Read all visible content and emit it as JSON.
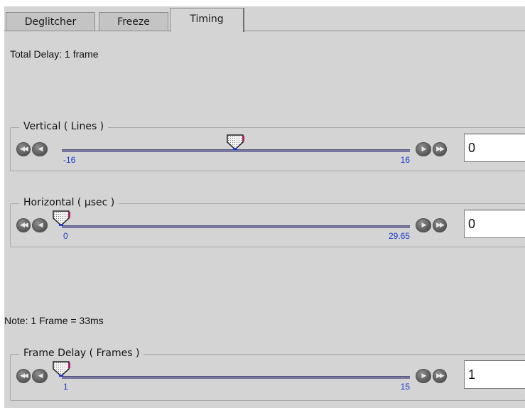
{
  "tabs": [
    {
      "label": "Deglitcher",
      "active": false
    },
    {
      "label": "Freeze",
      "active": false
    },
    {
      "label": "Timing",
      "active": true
    }
  ],
  "total_delay": "Total Delay: 1 frame",
  "note": "Note: 1 Frame = 33ms",
  "sliders": {
    "vertical": {
      "legend": "Vertical ( Lines )",
      "min": "-16",
      "max": "16",
      "value": "0",
      "level": 0.5
    },
    "horizontal": {
      "legend": "Horizontal ( µsec )",
      "min": "0",
      "max": "29.65",
      "value": "0",
      "level": 0.0
    },
    "frame_delay": {
      "legend": "Frame Delay ( Frames )",
      "min": "1",
      "max": "15",
      "value": "1",
      "level": 0.0
    }
  },
  "icons": {
    "first": "double-left-arrow-icon",
    "prev": "left-arrow-icon",
    "next": "right-arrow-icon",
    "last": "double-right-arrow-icon",
    "thumb": "slider-thumb-icon"
  },
  "colors": {
    "panel_bg": "#d4d4d4",
    "tab_bg": "#c4c4c4",
    "track": "#7777a0",
    "tick_label": "#1a3ccf",
    "thumb_accent": "#e0007a"
  }
}
